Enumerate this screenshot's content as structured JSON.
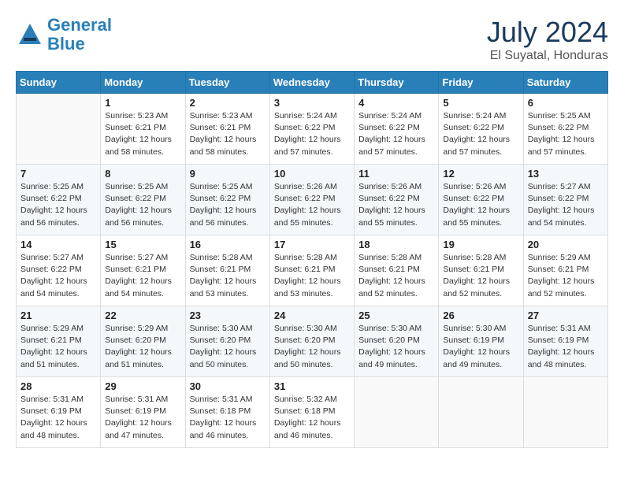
{
  "header": {
    "logo_line1": "General",
    "logo_line2": "Blue",
    "month": "July 2024",
    "location": "El Suyatal, Honduras"
  },
  "weekdays": [
    "Sunday",
    "Monday",
    "Tuesday",
    "Wednesday",
    "Thursday",
    "Friday",
    "Saturday"
  ],
  "weeks": [
    [
      {
        "day": "",
        "info": ""
      },
      {
        "day": "1",
        "info": "Sunrise: 5:23 AM\nSunset: 6:21 PM\nDaylight: 12 hours\nand 58 minutes."
      },
      {
        "day": "2",
        "info": "Sunrise: 5:23 AM\nSunset: 6:21 PM\nDaylight: 12 hours\nand 58 minutes."
      },
      {
        "day": "3",
        "info": "Sunrise: 5:24 AM\nSunset: 6:22 PM\nDaylight: 12 hours\nand 57 minutes."
      },
      {
        "day": "4",
        "info": "Sunrise: 5:24 AM\nSunset: 6:22 PM\nDaylight: 12 hours\nand 57 minutes."
      },
      {
        "day": "5",
        "info": "Sunrise: 5:24 AM\nSunset: 6:22 PM\nDaylight: 12 hours\nand 57 minutes."
      },
      {
        "day": "6",
        "info": "Sunrise: 5:25 AM\nSunset: 6:22 PM\nDaylight: 12 hours\nand 57 minutes."
      }
    ],
    [
      {
        "day": "7",
        "info": "Sunrise: 5:25 AM\nSunset: 6:22 PM\nDaylight: 12 hours\nand 56 minutes."
      },
      {
        "day": "8",
        "info": "Sunrise: 5:25 AM\nSunset: 6:22 PM\nDaylight: 12 hours\nand 56 minutes."
      },
      {
        "day": "9",
        "info": "Sunrise: 5:25 AM\nSunset: 6:22 PM\nDaylight: 12 hours\nand 56 minutes."
      },
      {
        "day": "10",
        "info": "Sunrise: 5:26 AM\nSunset: 6:22 PM\nDaylight: 12 hours\nand 55 minutes."
      },
      {
        "day": "11",
        "info": "Sunrise: 5:26 AM\nSunset: 6:22 PM\nDaylight: 12 hours\nand 55 minutes."
      },
      {
        "day": "12",
        "info": "Sunrise: 5:26 AM\nSunset: 6:22 PM\nDaylight: 12 hours\nand 55 minutes."
      },
      {
        "day": "13",
        "info": "Sunrise: 5:27 AM\nSunset: 6:22 PM\nDaylight: 12 hours\nand 54 minutes."
      }
    ],
    [
      {
        "day": "14",
        "info": "Sunrise: 5:27 AM\nSunset: 6:22 PM\nDaylight: 12 hours\nand 54 minutes."
      },
      {
        "day": "15",
        "info": "Sunrise: 5:27 AM\nSunset: 6:21 PM\nDaylight: 12 hours\nand 54 minutes."
      },
      {
        "day": "16",
        "info": "Sunrise: 5:28 AM\nSunset: 6:21 PM\nDaylight: 12 hours\nand 53 minutes."
      },
      {
        "day": "17",
        "info": "Sunrise: 5:28 AM\nSunset: 6:21 PM\nDaylight: 12 hours\nand 53 minutes."
      },
      {
        "day": "18",
        "info": "Sunrise: 5:28 AM\nSunset: 6:21 PM\nDaylight: 12 hours\nand 52 minutes."
      },
      {
        "day": "19",
        "info": "Sunrise: 5:28 AM\nSunset: 6:21 PM\nDaylight: 12 hours\nand 52 minutes."
      },
      {
        "day": "20",
        "info": "Sunrise: 5:29 AM\nSunset: 6:21 PM\nDaylight: 12 hours\nand 52 minutes."
      }
    ],
    [
      {
        "day": "21",
        "info": "Sunrise: 5:29 AM\nSunset: 6:21 PM\nDaylight: 12 hours\nand 51 minutes."
      },
      {
        "day": "22",
        "info": "Sunrise: 5:29 AM\nSunset: 6:20 PM\nDaylight: 12 hours\nand 51 minutes."
      },
      {
        "day": "23",
        "info": "Sunrise: 5:30 AM\nSunset: 6:20 PM\nDaylight: 12 hours\nand 50 minutes."
      },
      {
        "day": "24",
        "info": "Sunrise: 5:30 AM\nSunset: 6:20 PM\nDaylight: 12 hours\nand 50 minutes."
      },
      {
        "day": "25",
        "info": "Sunrise: 5:30 AM\nSunset: 6:20 PM\nDaylight: 12 hours\nand 49 minutes."
      },
      {
        "day": "26",
        "info": "Sunrise: 5:30 AM\nSunset: 6:19 PM\nDaylight: 12 hours\nand 49 minutes."
      },
      {
        "day": "27",
        "info": "Sunrise: 5:31 AM\nSunset: 6:19 PM\nDaylight: 12 hours\nand 48 minutes."
      }
    ],
    [
      {
        "day": "28",
        "info": "Sunrise: 5:31 AM\nSunset: 6:19 PM\nDaylight: 12 hours\nand 48 minutes."
      },
      {
        "day": "29",
        "info": "Sunrise: 5:31 AM\nSunset: 6:19 PM\nDaylight: 12 hours\nand 47 minutes."
      },
      {
        "day": "30",
        "info": "Sunrise: 5:31 AM\nSunset: 6:18 PM\nDaylight: 12 hours\nand 46 minutes."
      },
      {
        "day": "31",
        "info": "Sunrise: 5:32 AM\nSunset: 6:18 PM\nDaylight: 12 hours\nand 46 minutes."
      },
      {
        "day": "",
        "info": ""
      },
      {
        "day": "",
        "info": ""
      },
      {
        "day": "",
        "info": ""
      }
    ]
  ]
}
